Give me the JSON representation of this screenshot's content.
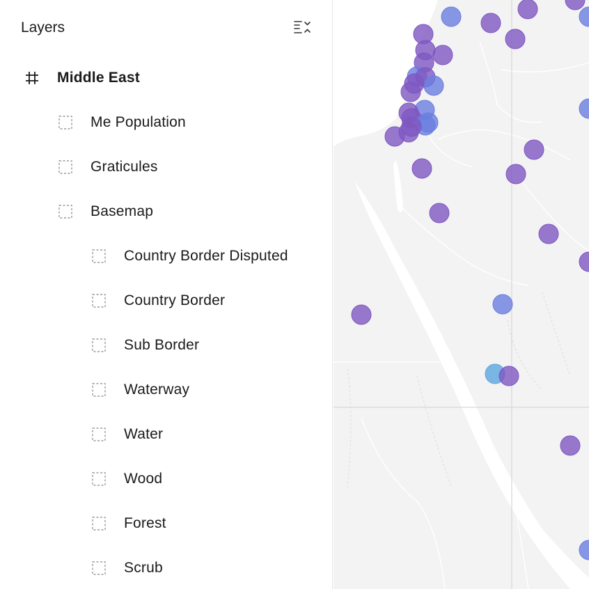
{
  "panel": {
    "title": "Layers",
    "collapse_icon": "collapse-all-icon"
  },
  "layers": [
    {
      "label": "Middle East",
      "level": 0,
      "type": "group",
      "icon": "frame-hash-icon"
    },
    {
      "label": "Me Population",
      "level": 1,
      "type": "layer",
      "icon": "dashed-square-icon"
    },
    {
      "label": "Graticules",
      "level": 1,
      "type": "layer",
      "icon": "dashed-square-icon"
    },
    {
      "label": "Basemap",
      "level": 1,
      "type": "layer",
      "icon": "dashed-square-icon"
    },
    {
      "label": "Country Border Disputed",
      "level": 2,
      "type": "layer",
      "icon": "dashed-square-icon"
    },
    {
      "label": "Country Border",
      "level": 2,
      "type": "layer",
      "icon": "dashed-square-icon"
    },
    {
      "label": "Sub Border",
      "level": 2,
      "type": "layer",
      "icon": "dashed-square-icon"
    },
    {
      "label": "Waterway",
      "level": 2,
      "type": "layer",
      "icon": "dashed-square-icon"
    },
    {
      "label": "Water",
      "level": 2,
      "type": "layer",
      "icon": "dashed-square-icon"
    },
    {
      "label": "Wood",
      "level": 2,
      "type": "layer",
      "icon": "dashed-square-icon"
    },
    {
      "label": "Forest",
      "level": 2,
      "type": "layer",
      "icon": "dashed-square-icon"
    },
    {
      "label": "Scrub",
      "level": 2,
      "type": "layer",
      "icon": "dashed-square-icon"
    }
  ],
  "map": {
    "colors": {
      "land": "#f3f3f3",
      "water": "#ffffff",
      "border": "#ffffff",
      "graticule": "#d6d6d6",
      "marker_purple": "#7e57c2",
      "marker_blue": "#6a7ee0",
      "marker_sky": "#5aa6e0"
    }
  }
}
